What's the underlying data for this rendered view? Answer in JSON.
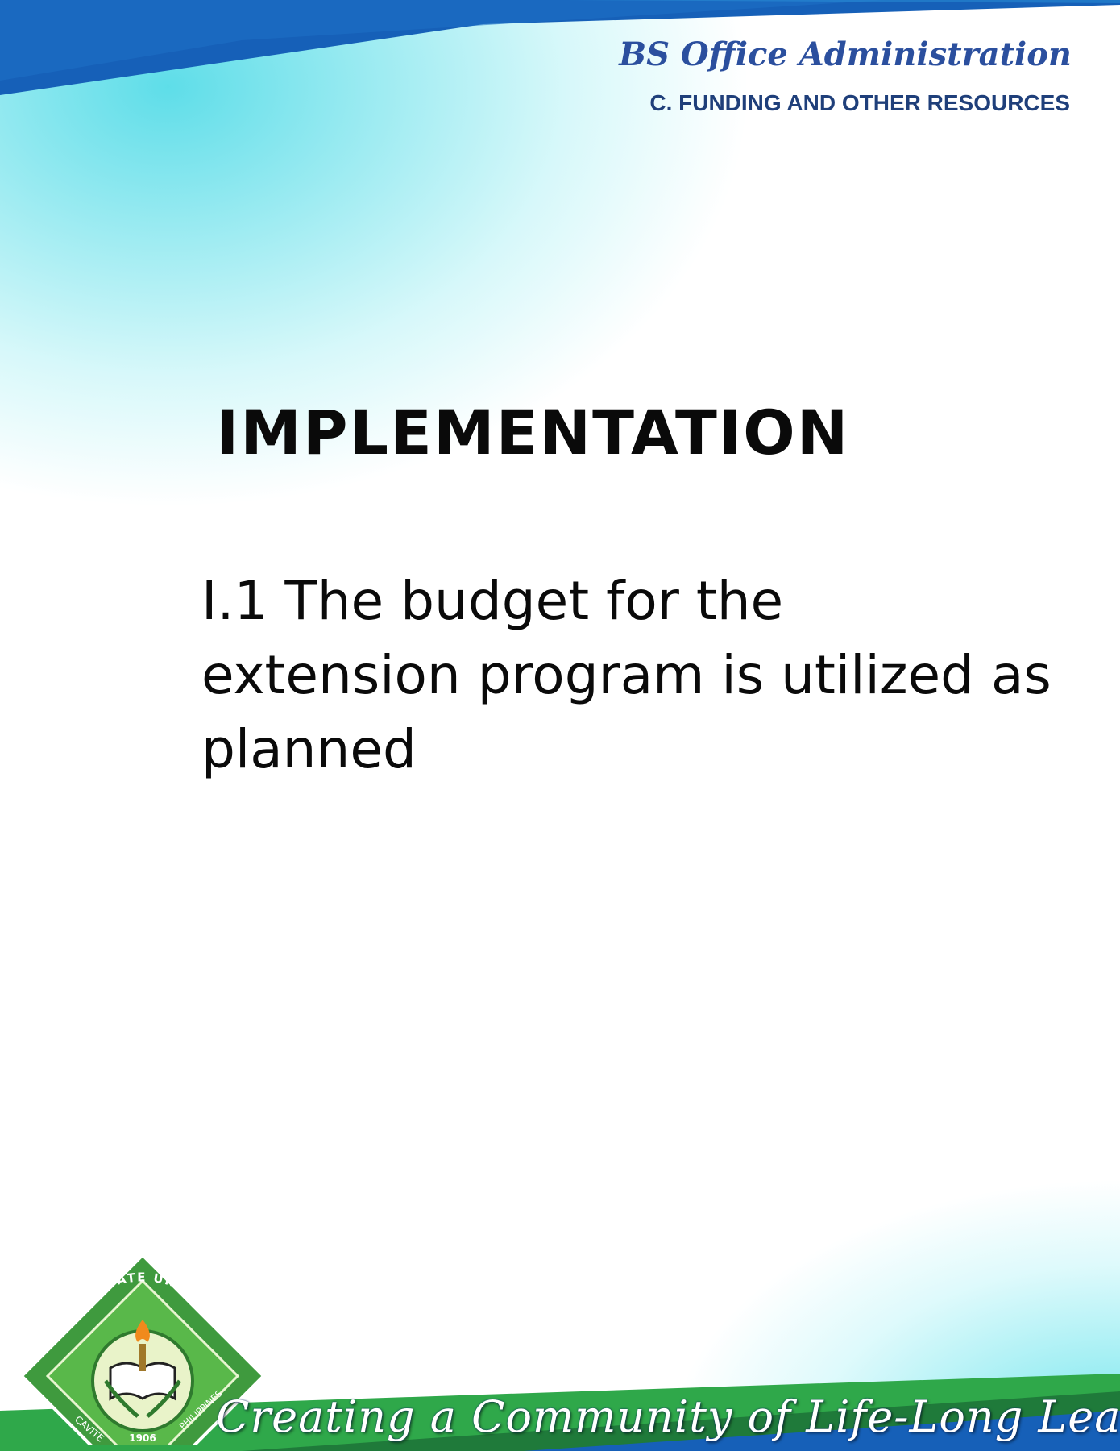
{
  "header": {
    "program": "BS Office Administration",
    "section": "C. FUNDING AND OTHER RESOURCES"
  },
  "main": {
    "heading": "IMPLEMENTATION",
    "criterion": "I.1 The budget for the extension program is utilized as planned"
  },
  "footer": {
    "tagline": "Creating a Community of Life-Long Learners",
    "seal": {
      "name": "CAVITE STATE UNIVERSITY",
      "top_text": "CAVITE STATE UNIVERSITY",
      "left_text": "CAVITE",
      "right_text": "PHILIPPINES",
      "year": "1906"
    }
  },
  "colors": {
    "title_blue": "#2b4f9e",
    "subtitle_navy": "#1f3f7a",
    "band_blue": "#1660b8",
    "band_green": "#2fa84a",
    "teal": "#2fd3de",
    "seal_green": "#3f9a3e"
  }
}
